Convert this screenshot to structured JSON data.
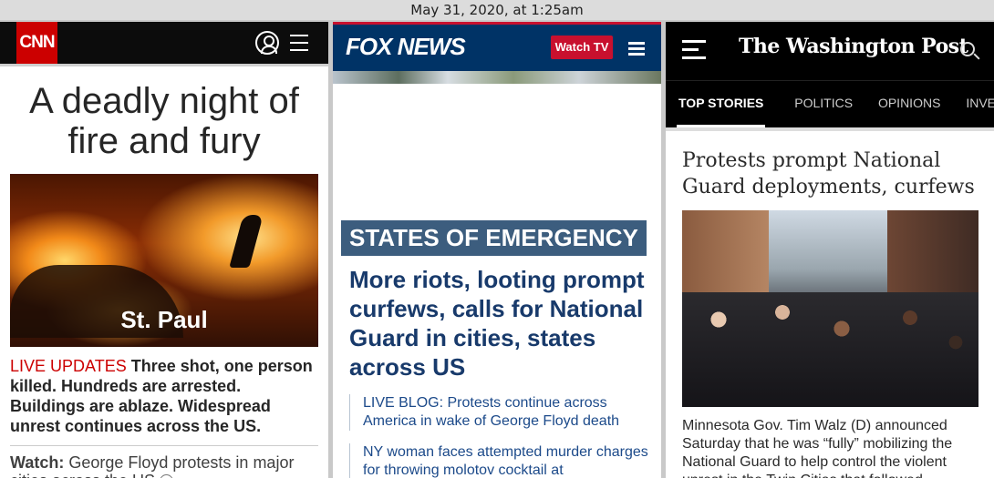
{
  "timestamp": "May 31, 2020, at 1:25am",
  "cnn": {
    "logo": "CNN",
    "headline": "A deadly night of fire and fury",
    "photo_caption": "St. Paul",
    "live_label": "LIVE UPDATES",
    "summary": "Three shot, one person killed. Hundreds are arrested. Buildings are ablaze. Widespread unrest continues across the US.",
    "watch_label": "Watch:",
    "watch_text": "George Floyd protests in major cities across the US",
    "icons": [
      "user-icon",
      "menu-icon",
      "play-icon"
    ],
    "accent": "#cc0000"
  },
  "fox": {
    "logo": "FOX NEWS",
    "watch_tv": "Watch TV",
    "tag": "STATES OF EMERGENCY",
    "headline": "More riots, looting prompt curfews, calls for National Guard in cities, states across US",
    "stories": [
      "LIVE BLOG: Protests continue across America in wake of George Floyd death",
      "NY woman faces attempted murder charges for throwing molotov cocktail at"
    ],
    "icons": [
      "menu-icon"
    ],
    "brand": "#003366"
  },
  "wapo": {
    "logo": "The Washington Post",
    "nav": [
      "TOP STORIES",
      "POLITICS",
      "OPINIONS",
      "INVESTIGA"
    ],
    "headline": "Protests prompt National Guard deployments, curfews",
    "summary": "Minnesota Gov. Tim Walz (D) announced Saturday that he was “fully” mobilizing the National Guard to help control the violent unrest in the Twin Cities that followed",
    "icons": [
      "menu-icon",
      "search-icon"
    ]
  }
}
